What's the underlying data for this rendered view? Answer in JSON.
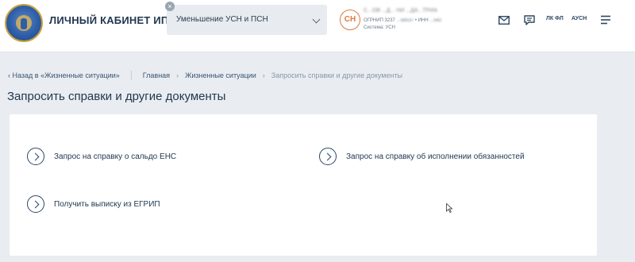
{
  "header": {
    "brand": "ЛИЧНЫЙ КАБИНЕТ ИП",
    "mode_select": "Уменьшение УСН и ПСН",
    "mode_close": "×",
    "avatar": "СН",
    "user_name": "С...ОВ ...Д... НИ ...ДА...ТРИА",
    "ogrnip_label": "ОГРНИП 3237",
    "ogrnip_value": "...58537",
    "inn_label": "• ИНН",
    "inn_value": "...542",
    "system": "Система: УСН",
    "icons": [
      "mail-icon",
      "chat-icon"
    ],
    "link_fl": "ЛК ФЛ",
    "link_ausn": "АУСН"
  },
  "breadcrumb": {
    "back": "‹  Назад в «Жизненные ситуации»",
    "home": "Главная",
    "section": "Жизненные ситуации",
    "current": "Запросить справки и другие документы",
    "sep": "›"
  },
  "page_title": "Запросить справки и другие документы",
  "links": [
    "Запрос на справку о сальдо ЕНС",
    "Запрос на справку об исполнении обязанностей",
    "Получить выписку из ЕГРИП"
  ],
  "colors": {
    "accent": "#e07a3c",
    "primary_text": "#1f3550",
    "background": "#e9edf1"
  }
}
